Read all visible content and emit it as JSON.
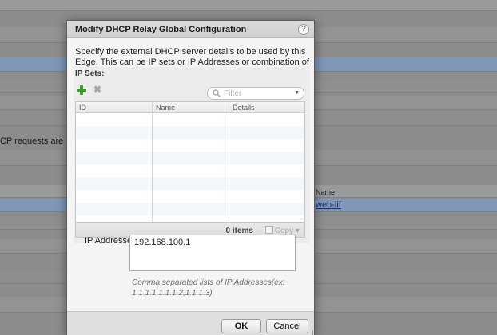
{
  "background": {
    "relay_text": "CP requests are rela",
    "name_header": "Name",
    "interface_link": "web-lif"
  },
  "dialog": {
    "title": "Modify DHCP Relay Global Configuration",
    "help_label": "?",
    "description": "Specify the external DHCP server details to be used by this Edge. This can be IP sets or IP Addresses or combination of them.",
    "ip_sets": {
      "label": "IP Sets:",
      "add_icon": "green-plus-icon",
      "delete_icon": "gray-x-icon",
      "delete_glyph": "✖",
      "filter_placeholder": "Filter",
      "filter_caret": "▼",
      "columns": [
        "ID",
        "Name",
        "Details"
      ],
      "rows": [],
      "item_count": "0 items",
      "copy_label": "Copy",
      "copy_caret": "▾"
    },
    "ip_addresses": {
      "label": "IP Addresses:",
      "value": "192.168.100.1",
      "hint": "Comma separated lists of IP Addresses(ex: 1.1.1.1,1.1.1.2,1.1.1.3)"
    },
    "buttons": {
      "ok": "OK",
      "cancel": "Cancel"
    }
  },
  "colors": {
    "overlay": "#8c8c8c",
    "selected_row": "#7e97b4",
    "add_icon_green": "#3a9a2a"
  }
}
